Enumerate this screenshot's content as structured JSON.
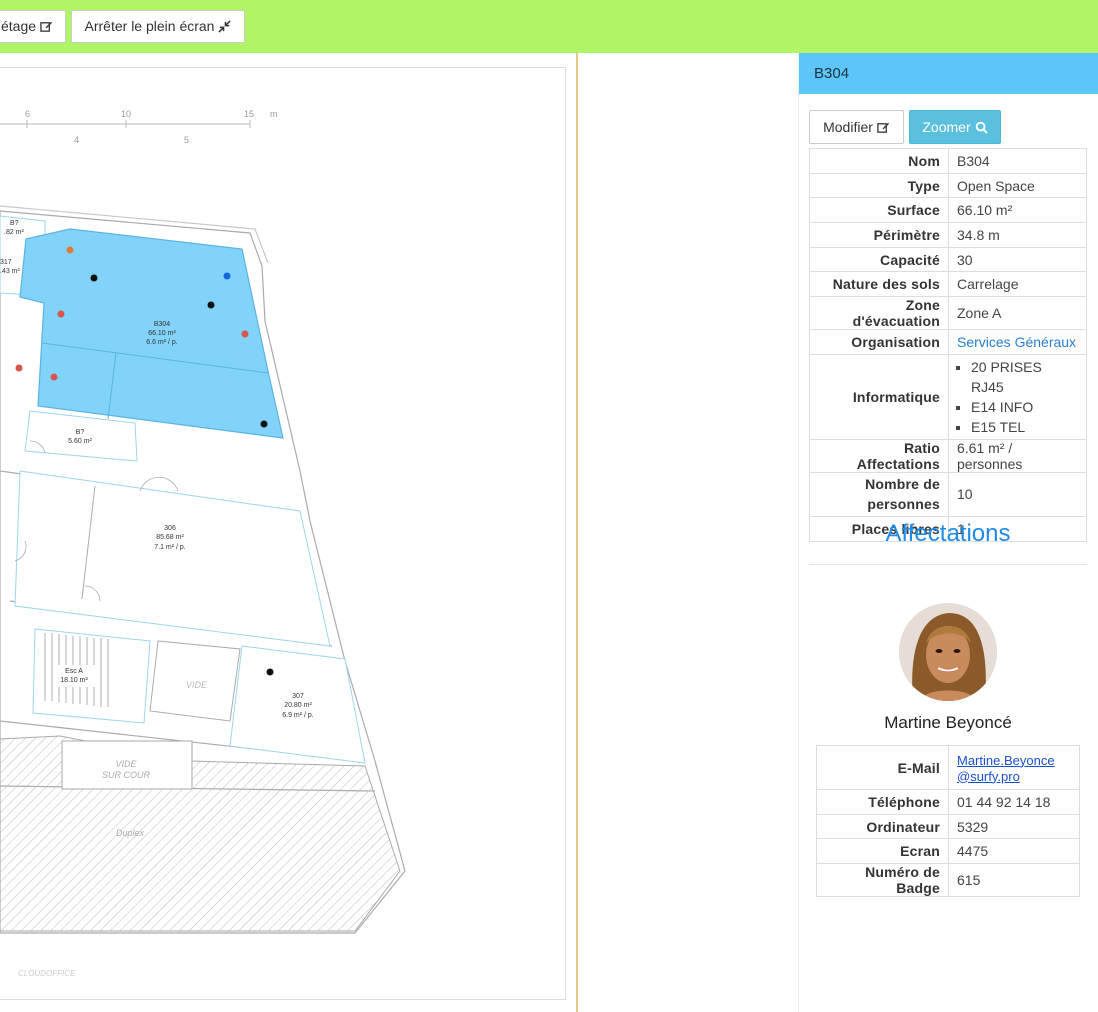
{
  "toolbar": {
    "floor_button_label": "étage",
    "fullscreen_button_label": "Arrêter le plein écran"
  },
  "plan": {
    "scale_top": [
      "6",
      "10",
      "15",
      "m"
    ],
    "scale_bottom": [
      "4",
      "5"
    ],
    "rooms": [
      {
        "name": "B304",
        "area": "66.10 m²",
        "ratio": "6.6 m² / p."
      },
      {
        "name": "306",
        "area": "85.68 m²",
        "ratio": "7.1 m² / p."
      },
      {
        "name": "307",
        "area": "20.80 m²",
        "ratio": "6.9 m² / p."
      },
      {
        "name": "B?",
        "area": "5.60 m²"
      },
      {
        "name": "Esc A",
        "area": "18.10 m²"
      }
    ],
    "partial_labels": [
      "B?",
      ".82 m²",
      "317",
      ".43 m²"
    ],
    "void_label": "VIDE",
    "void_court_label_1": "VIDE",
    "void_court_label_2": "SUR COUR",
    "hatched_label": "Duplex",
    "credit": "CLOUDOFFICE"
  },
  "panel": {
    "header": "B304",
    "modify_label": "Modifier",
    "zoom_label": "Zoomer",
    "properties": [
      {
        "label": "Nom",
        "value": "B304"
      },
      {
        "label": "Type",
        "value": "Open Space"
      },
      {
        "label": "Surface",
        "value": "66.10 m²"
      },
      {
        "label": "Périmètre",
        "value": "34.8 m"
      },
      {
        "label": "Capacité",
        "value": "30"
      },
      {
        "label": "Nature des sols",
        "value": "Carrelage"
      },
      {
        "label": "Zone d'évacuation",
        "value": "Zone A"
      },
      {
        "label": "Organisation",
        "value": "Services Généraux"
      },
      {
        "label": "Informatique",
        "items": [
          "20 PRISES RJ45",
          "E14 INFO",
          "E15 TEL"
        ]
      },
      {
        "label": "Ratio Affectations",
        "value": "6.61 m² / personnes"
      },
      {
        "label": "Nombre de personnes",
        "value": "10"
      },
      {
        "label": "Places libres",
        "value": "1"
      }
    ],
    "affectations_title": "Affectations",
    "person": {
      "name": "Martine Beyoncé",
      "contact": [
        {
          "label": "E-Mail",
          "value_line1": "Martine.Beyonce",
          "value_line2": "@surfy.pro"
        },
        {
          "label": "Téléphone",
          "value": "01 44 92 14 18"
        },
        {
          "label": "Ordinateur",
          "value": "5329"
        },
        {
          "label": "Ecran",
          "value": "4475"
        },
        {
          "label": "Numéro de Badge",
          "value": "615"
        }
      ]
    }
  },
  "colors": {
    "topbar": "#b0f566",
    "selected_room": "#82d3fa",
    "panel_header": "#5bc6f7",
    "accent_link": "#2a7fd4"
  }
}
